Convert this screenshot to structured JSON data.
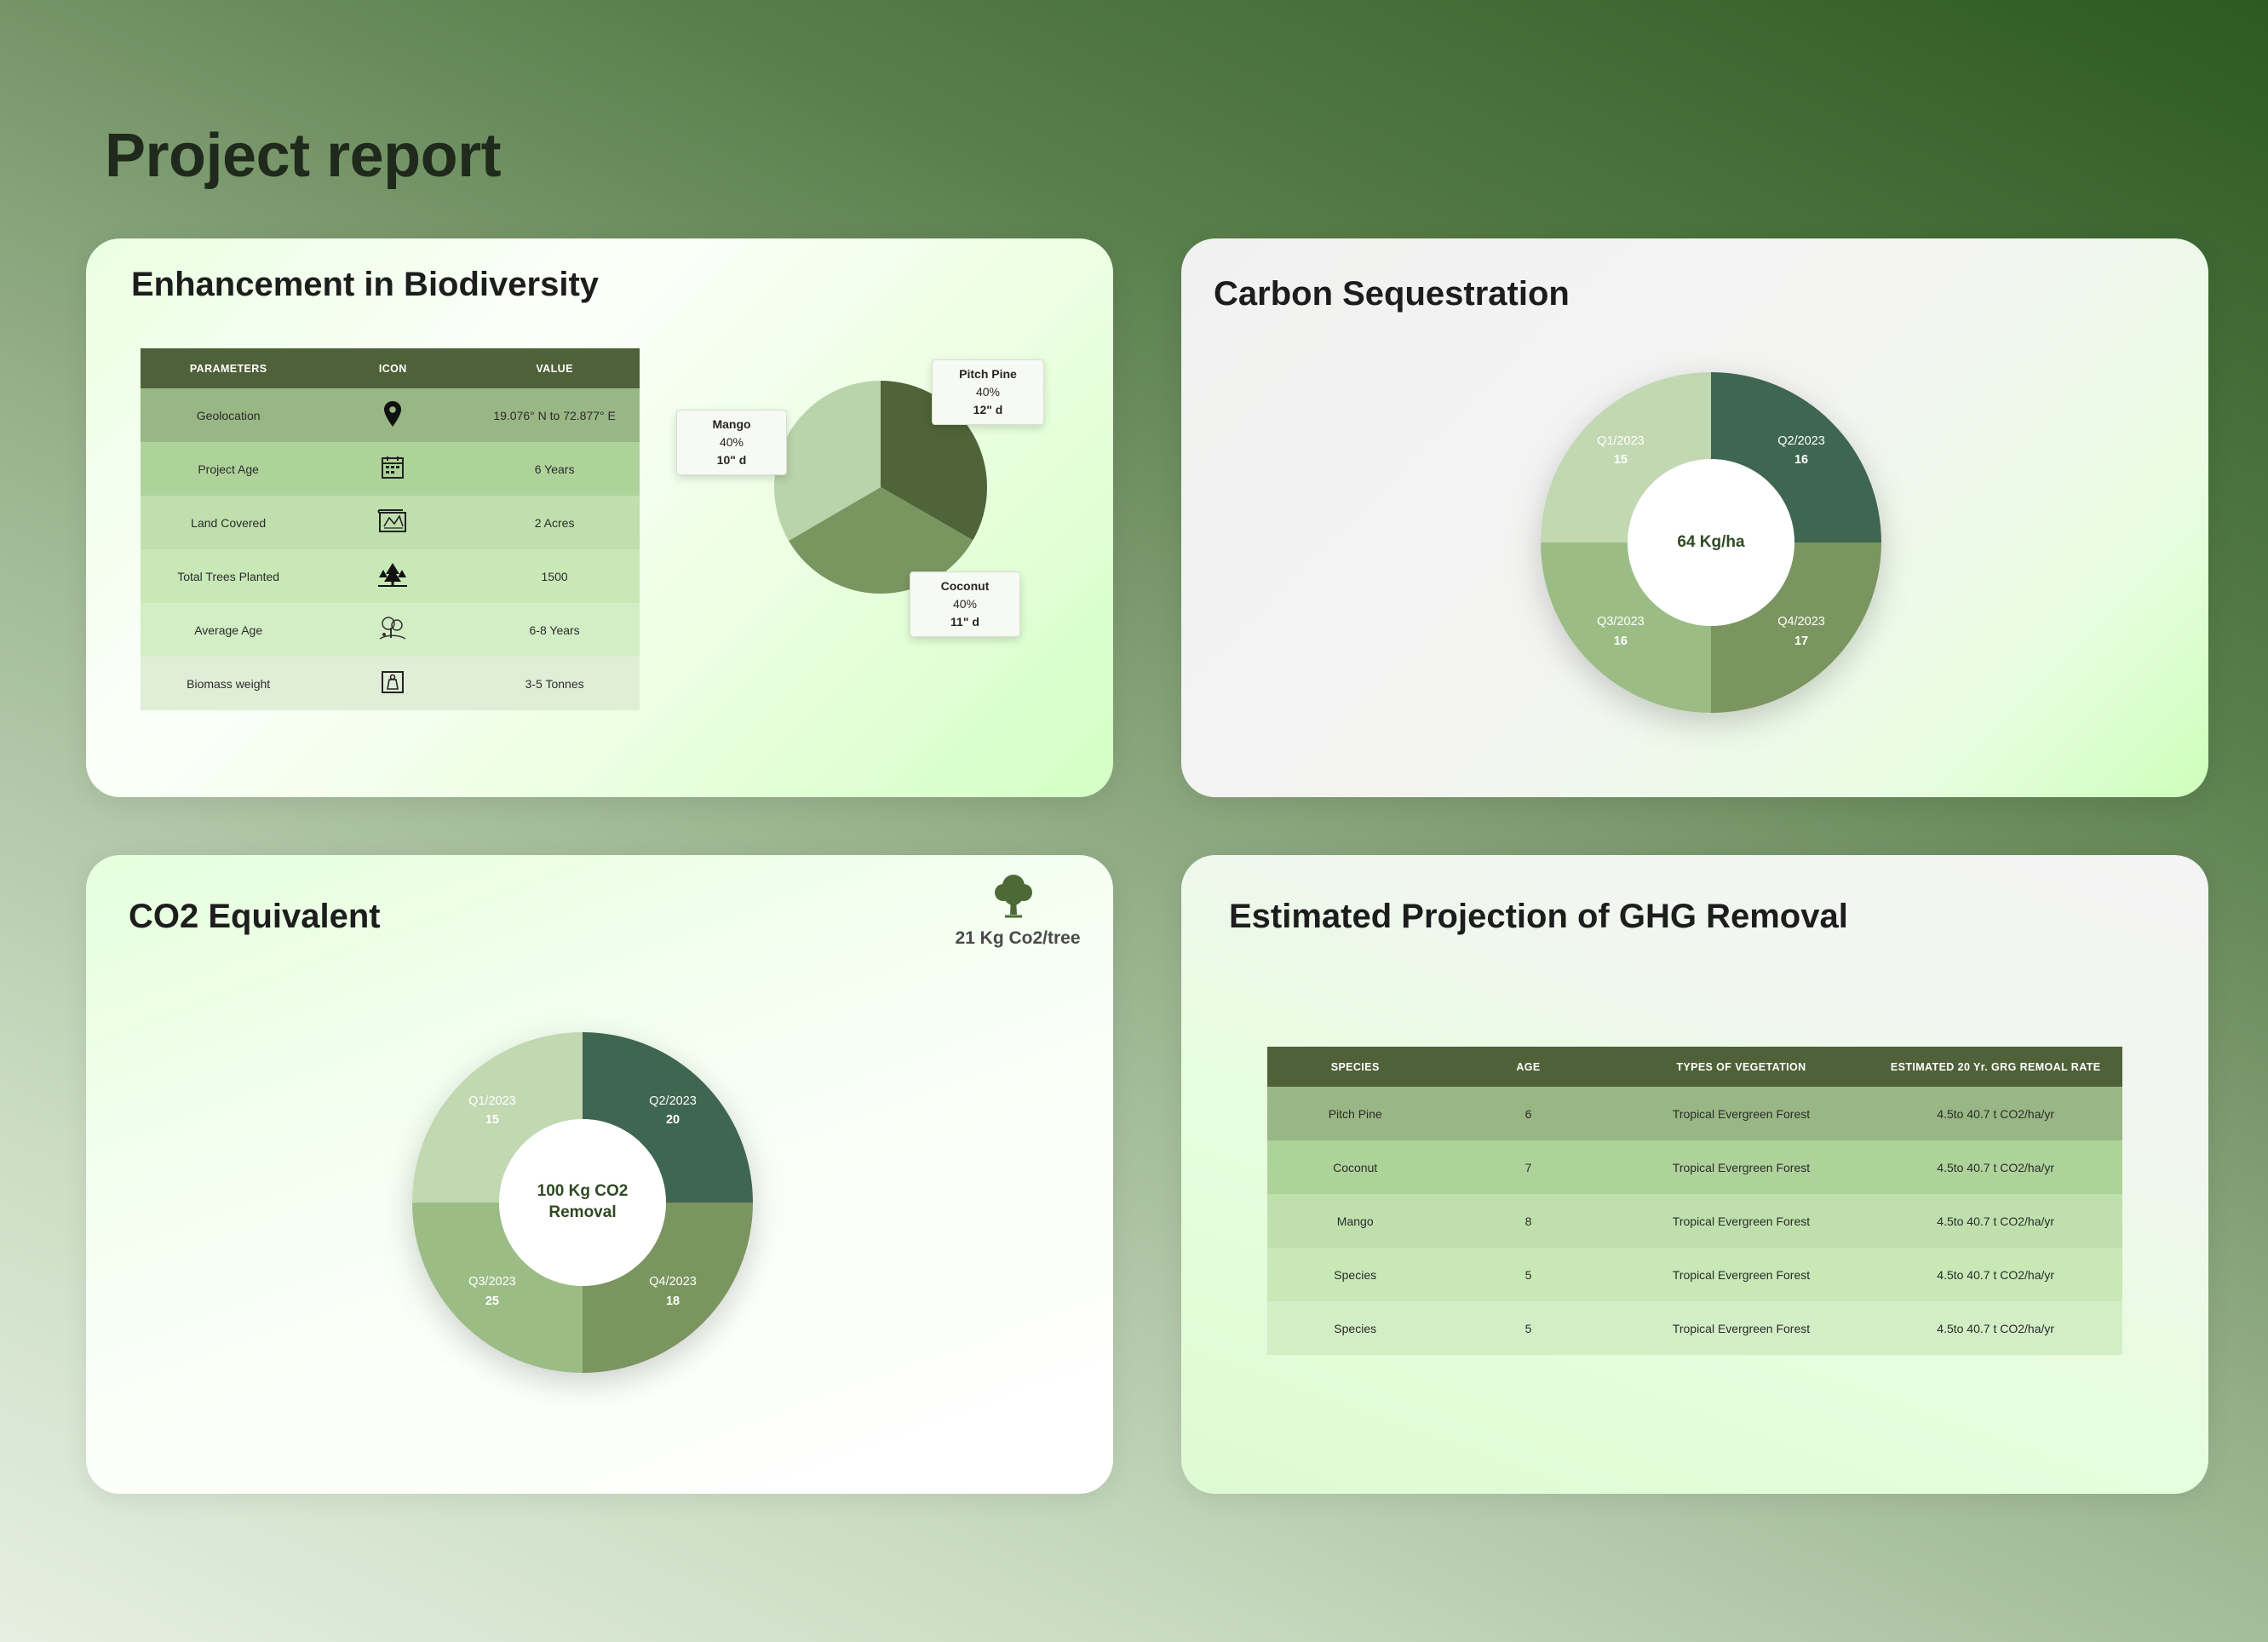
{
  "page": {
    "title": "Project report"
  },
  "biodiversity": {
    "title": "Enhancement in Biodiversity",
    "table": {
      "headers": [
        "PARAMETERS",
        "ICON",
        "VALUE"
      ],
      "rows": [
        {
          "parameter": "Geolocation",
          "icon": "location-pin-icon",
          "value": "19.076° N to 72.877° E"
        },
        {
          "parameter": "Project Age",
          "icon": "calendar-icon",
          "value": "6 Years"
        },
        {
          "parameter": "Land Covered",
          "icon": "map-icon",
          "value": "2 Acres"
        },
        {
          "parameter": "Total Trees Planted",
          "icon": "trees-icon",
          "value": "1500"
        },
        {
          "parameter": "Average Age",
          "icon": "tree-age-icon",
          "value": "6-8 Years"
        },
        {
          "parameter": "Biomass weight",
          "icon": "weight-icon",
          "value": "3-5 Tonnes"
        }
      ]
    }
  },
  "carbon": {
    "title": "Carbon Sequestration",
    "center_label": "64 Kg/ha"
  },
  "co2": {
    "title": "CO2 Equivalent",
    "per_tree": "21 Kg Co2/tree",
    "per_tree_icon": "tree-icon",
    "center_label_line1": "100 Kg CO2",
    "center_label_line2": "Removal"
  },
  "ghg": {
    "title": "Estimated Projection of GHG Removal",
    "headers": [
      "SPECIES",
      "AGE",
      "TYPES OF VEGETATION",
      "ESTIMATED 20 Yr. GRG REMOAL RATE"
    ],
    "rows": [
      {
        "species": "Pitch Pine",
        "age": "6",
        "vegetation": "Tropical Evergreen Forest",
        "rate": "4.5to 40.7 t CO2/ha/yr"
      },
      {
        "species": "Coconut",
        "age": "7",
        "vegetation": "Tropical Evergreen Forest",
        "rate": "4.5to 40.7 t CO2/ha/yr"
      },
      {
        "species": "Mango",
        "age": "8",
        "vegetation": "Tropical Evergreen Forest",
        "rate": "4.5to 40.7 t CO2/ha/yr"
      },
      {
        "species": "Species",
        "age": "5",
        "vegetation": "Tropical Evergreen Forest",
        "rate": "4.5to 40.7 t CO2/ha/yr"
      },
      {
        "species": "Species",
        "age": "5",
        "vegetation": "Tropical Evergreen Forest",
        "rate": "4.5to 40.7 t CO2/ha/yr"
      }
    ]
  },
  "chart_data": [
    {
      "type": "pie",
      "categories": [
        "Pitch Pine",
        "Coconut",
        "Mango"
      ],
      "values": [
        33.3,
        33.3,
        33.4
      ],
      "labels": [
        {
          "name": "Pitch Pine",
          "percent": "40%",
          "value": "12\" d"
        },
        {
          "name": "Coconut",
          "percent": "40%",
          "value": "11\" d"
        },
        {
          "name": "Mango",
          "percent": "40%",
          "value": "10\" d"
        }
      ],
      "colors": [
        "#4f6438",
        "#7a9660",
        "#b9d3aa"
      ]
    },
    {
      "type": "pie",
      "style": "donut",
      "categories": [
        "Q2/2023",
        "Q4/2023",
        "Q3/2023",
        "Q1/2023"
      ],
      "values": [
        16,
        17,
        16,
        15
      ],
      "colors": [
        "#3f6650",
        "#7a955f",
        "#9bbd85",
        "#c1d8b1"
      ],
      "center": "64 Kg/ha"
    },
    {
      "type": "pie",
      "style": "donut",
      "categories": [
        "Q2/2023",
        "Q4/2023",
        "Q3/2023",
        "Q1/2023"
      ],
      "values": [
        20,
        18,
        25,
        15
      ],
      "colors": [
        "#3f6650",
        "#7a955f",
        "#9bbd85",
        "#c1d8b1"
      ],
      "center": "100 Kg CO2 Removal"
    }
  ]
}
